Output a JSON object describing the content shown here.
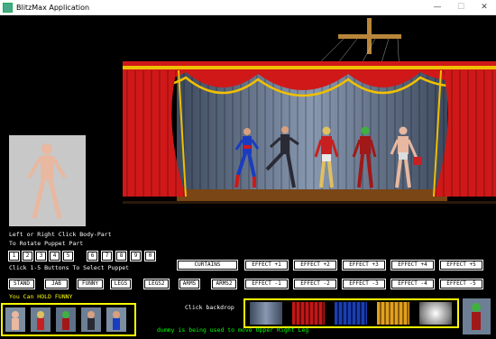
{
  "window": {
    "title": "BlitzMax Application",
    "minimize_icon": "—",
    "maximize_icon": "☐",
    "close_icon": "✕"
  },
  "instructions": {
    "line1": "Left or Right Click Body-Part",
    "line2": "To Rotate Puppet Part",
    "line3": "Click 1-5 Buttons To Select Puppet",
    "hold_funny": "You Can HOLD FUNNY"
  },
  "number_buttons": [
    "1",
    "2",
    "3",
    "4",
    "5",
    "6",
    "7",
    "8",
    "9",
    "0"
  ],
  "pose_buttons": [
    "STAND",
    "JAB",
    "FUNNY",
    "LEGS",
    "LEGS2",
    "ARMS",
    "ARMS2"
  ],
  "curtains_label": "CURTAINS",
  "effects_plus": [
    "EFFECT +1",
    "EFFECT +2",
    "EFFECT +3",
    "EFFECT +4",
    "EFFECT +5"
  ],
  "effects_minus": [
    "EFFECT -1",
    "EFFECT -2",
    "EFFECT -3",
    "EFFECT -4",
    "EFFECT -5"
  ],
  "backdrop_label": "Click backdrop",
  "status_message": "dummy is being used to move Upper Right Leg",
  "backdrops": [
    {
      "name": "grey-curtain",
      "color": "#6a7d95"
    },
    {
      "name": "red-curtain",
      "color": "#c01818"
    },
    {
      "name": "blue-curtain",
      "color": "#1a3fb0"
    },
    {
      "name": "gold-curtain",
      "color": "#e0a020"
    },
    {
      "name": "white-glow",
      "color": "#e8e8e8"
    }
  ],
  "puppet_thumbs": [
    {
      "name": "dummy",
      "color": "#e8b0a0"
    },
    {
      "name": "red-robot",
      "color": "#c82020"
    },
    {
      "name": "green-monster",
      "color": "#228833"
    },
    {
      "name": "suited-man",
      "color": "#303040"
    },
    {
      "name": "superhero",
      "color": "#2040b0"
    }
  ],
  "colors": {
    "accent_yellow": "#ffff00",
    "status_green": "#00ff00",
    "stage_red": "#d01818",
    "stage_gold": "#f0c000"
  }
}
